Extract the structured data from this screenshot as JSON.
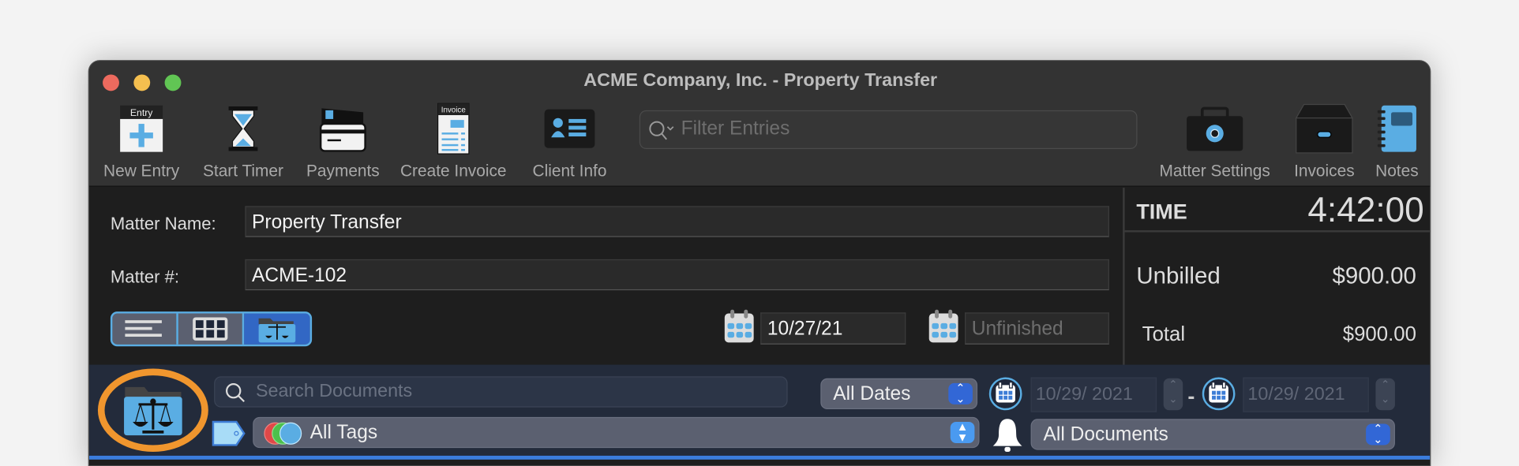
{
  "window": {
    "title": "ACME Company, Inc. - Property Transfer"
  },
  "toolbar": {
    "items": [
      {
        "label": "New Entry",
        "badge": "Entry",
        "icon": "new-entry-icon"
      },
      {
        "label": "Start Timer",
        "icon": "hourglass-icon"
      },
      {
        "label": "Payments",
        "icon": "credit-card-icon"
      },
      {
        "label": "Create Invoice",
        "badge": "Invoice",
        "icon": "invoice-icon"
      },
      {
        "label": "Client Info",
        "icon": "contact-card-icon"
      }
    ],
    "right_items": [
      {
        "label": "Matter Settings",
        "icon": "toolbox-gear-icon"
      },
      {
        "label": "Invoices",
        "icon": "file-cabinet-icon"
      },
      {
        "label": "Notes",
        "icon": "notebook-icon"
      }
    ],
    "filter_placeholder": "Filter Entries"
  },
  "matter": {
    "name_label": "Matter Name:",
    "name_value": "Property Transfer",
    "number_label": "Matter #:",
    "number_value": "ACME-102",
    "start_date": "10/27/21",
    "end_placeholder": "Unfinished",
    "view_modes": [
      "list",
      "grid",
      "documents"
    ],
    "selected_view": "documents"
  },
  "summary": {
    "time_label": "TIME",
    "time_value": "4:42:00",
    "unbilled_label": "Unbilled",
    "unbilled_value": "$900.00",
    "total_label": "Total",
    "total_value": "$900.00"
  },
  "documents": {
    "search_placeholder": "Search Documents",
    "date_filter": "All Dates",
    "date_from": "10/29/ 2021",
    "date_sep": "-",
    "date_to": "10/29/ 2021",
    "tags_filter": "All Tags",
    "doc_filter": "All Documents"
  },
  "colors": {
    "accent": "#3b7ddd",
    "highlight_ring": "#f0962e",
    "icon_blue": "#5aade3"
  }
}
